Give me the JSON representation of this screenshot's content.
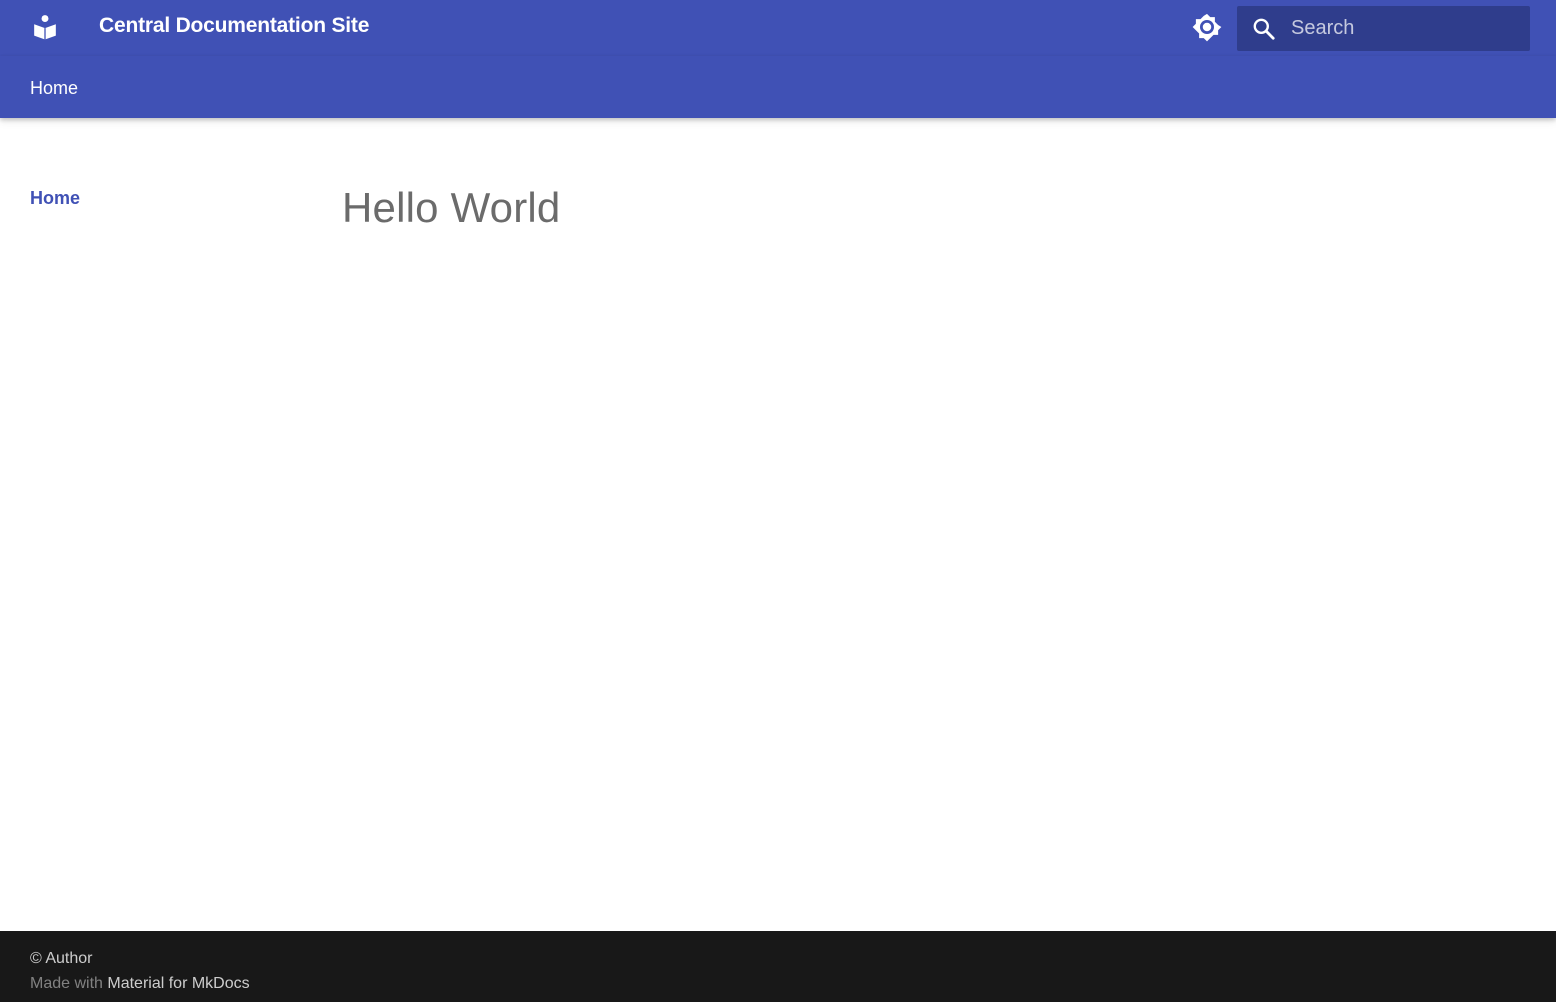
{
  "header": {
    "site_title": "Central Documentation Site",
    "logo_icon": "book-reader-icon",
    "theme_toggle_icon": "brightness-icon",
    "search": {
      "placeholder": "Search",
      "value": "",
      "icon": "search-icon"
    }
  },
  "tabs": [
    {
      "label": "Home"
    }
  ],
  "sidebar": {
    "items": [
      {
        "label": "Home",
        "active": true
      }
    ]
  },
  "content": {
    "title": "Hello World"
  },
  "footer": {
    "copyright": "© Author",
    "made_with_prefix": "Made with",
    "made_with_link": "Material for MkDocs"
  },
  "colors": {
    "primary": "#4051b5",
    "search_bg": "#2f3d8c",
    "footer_bg": "#181818",
    "title_text": "#6b6b6b"
  }
}
